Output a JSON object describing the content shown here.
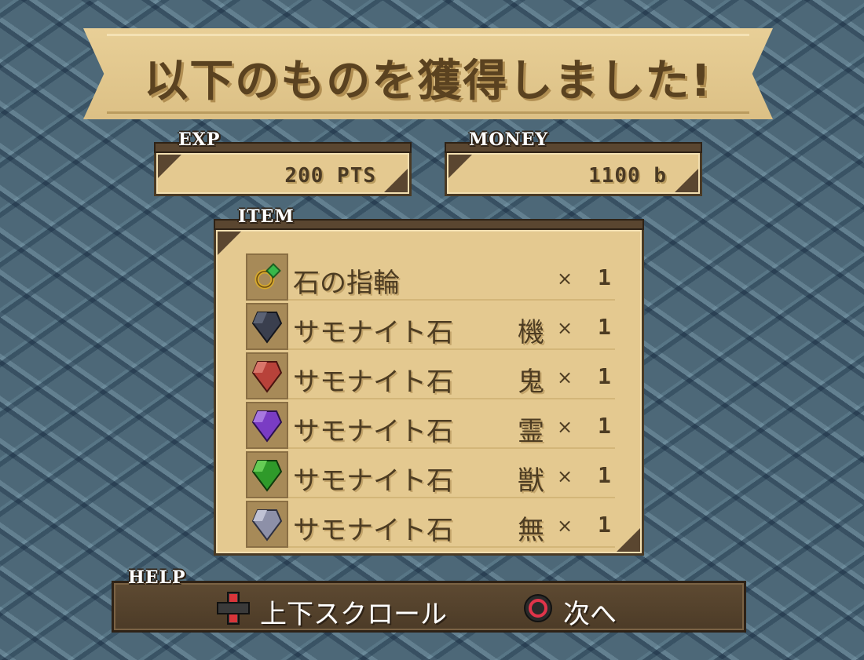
{
  "banner": {
    "title": "以下のものを獲得しました!"
  },
  "exp": {
    "label": "EXP",
    "value": "200 PTS"
  },
  "money": {
    "label": "MONEY",
    "value": "1100 b"
  },
  "items_panel": {
    "label": "ITEM",
    "items": [
      {
        "icon": "ring-icon",
        "name": "石の指輪",
        "attr": "",
        "times": "×",
        "qty": "1"
      },
      {
        "icon": "black-gem-icon",
        "name": "サモナイト石",
        "attr": "機",
        "times": "×",
        "qty": "1"
      },
      {
        "icon": "red-gem-icon",
        "name": "サモナイト石",
        "attr": "鬼",
        "times": "×",
        "qty": "1"
      },
      {
        "icon": "purple-gem-icon",
        "name": "サモナイト石",
        "attr": "霊",
        "times": "×",
        "qty": "1"
      },
      {
        "icon": "green-gem-icon",
        "name": "サモナイト石",
        "attr": "獣",
        "times": "×",
        "qty": "1"
      },
      {
        "icon": "gray-gem-icon",
        "name": "サモナイト石",
        "attr": "無",
        "times": "×",
        "qty": "1"
      }
    ]
  },
  "help": {
    "label": "HELP",
    "scroll_text": "上下スクロール",
    "next_text": "次へ"
  },
  "colors": {
    "parchment": "#e4c990",
    "wood_dark": "#5a4630",
    "text_brown": "#4d3c22",
    "gem_black": "#3a3f4e",
    "gem_red": "#b8423a",
    "gem_purple": "#7a3cc4",
    "gem_green": "#2f9a2a",
    "gem_gray": "#8d90a8"
  }
}
